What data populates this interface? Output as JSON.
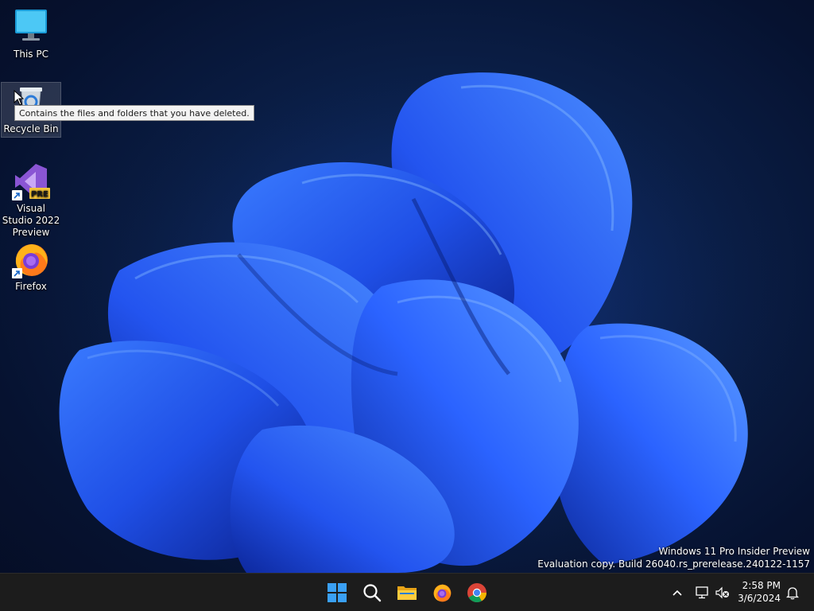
{
  "desktop": {
    "icons": [
      {
        "label": "This PC",
        "icon": "computer-monitor-icon"
      },
      {
        "label": "Recycle Bin",
        "icon": "recycle-bin-icon"
      },
      {
        "label": "Visual Studio 2022 Preview",
        "icon": "visual-studio-icon",
        "badge": "PRE"
      },
      {
        "label": "Firefox",
        "icon": "firefox-icon"
      }
    ],
    "tooltip": "Contains the files and folders that you have deleted."
  },
  "watermark": {
    "line1": "Windows 11 Pro Insider Preview",
    "line2": "Evaluation copy. Build 26040.rs_prerelease.240122-1157"
  },
  "taskbar": {
    "pinned": [
      "windows-start-icon",
      "search-icon",
      "file-explorer-icon",
      "firefox-icon",
      "chrome-icon"
    ],
    "tray_icons": [
      "chevron-up-icon",
      "network-icon",
      "volume-muted-icon",
      "notification-bell-icon"
    ],
    "clock": {
      "time": "2:58 PM",
      "date": "3/6/2024"
    }
  },
  "colors": {
    "taskbar_bg": "#1c1c1c",
    "accent_blue": "#2a5cff",
    "tooltip_bg": "#f3f3f3"
  }
}
